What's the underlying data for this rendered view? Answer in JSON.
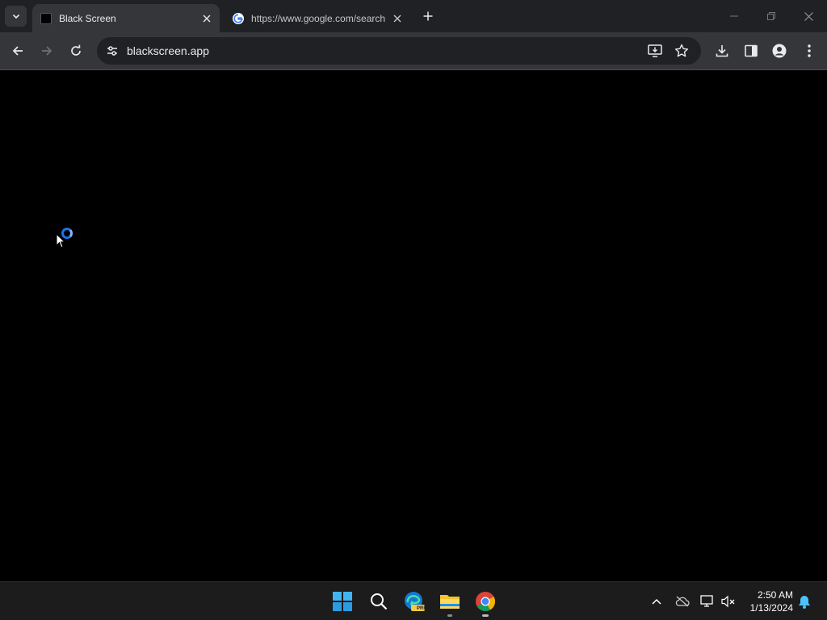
{
  "browser": {
    "tabs": [
      {
        "title": "Black Screen",
        "active": true
      },
      {
        "title": "https://www.google.com/search",
        "active": false
      }
    ],
    "url": "blackscreen.app"
  },
  "taskbar": {
    "time": "2:50 AM",
    "date": "1/13/2024",
    "edge_badge": "PRE"
  },
  "colors": {
    "tab_strip": "#202124",
    "toolbar": "#35363a",
    "page_background": "#000000",
    "taskbar": "#1c1c1c",
    "accent": "#1a73e8"
  }
}
